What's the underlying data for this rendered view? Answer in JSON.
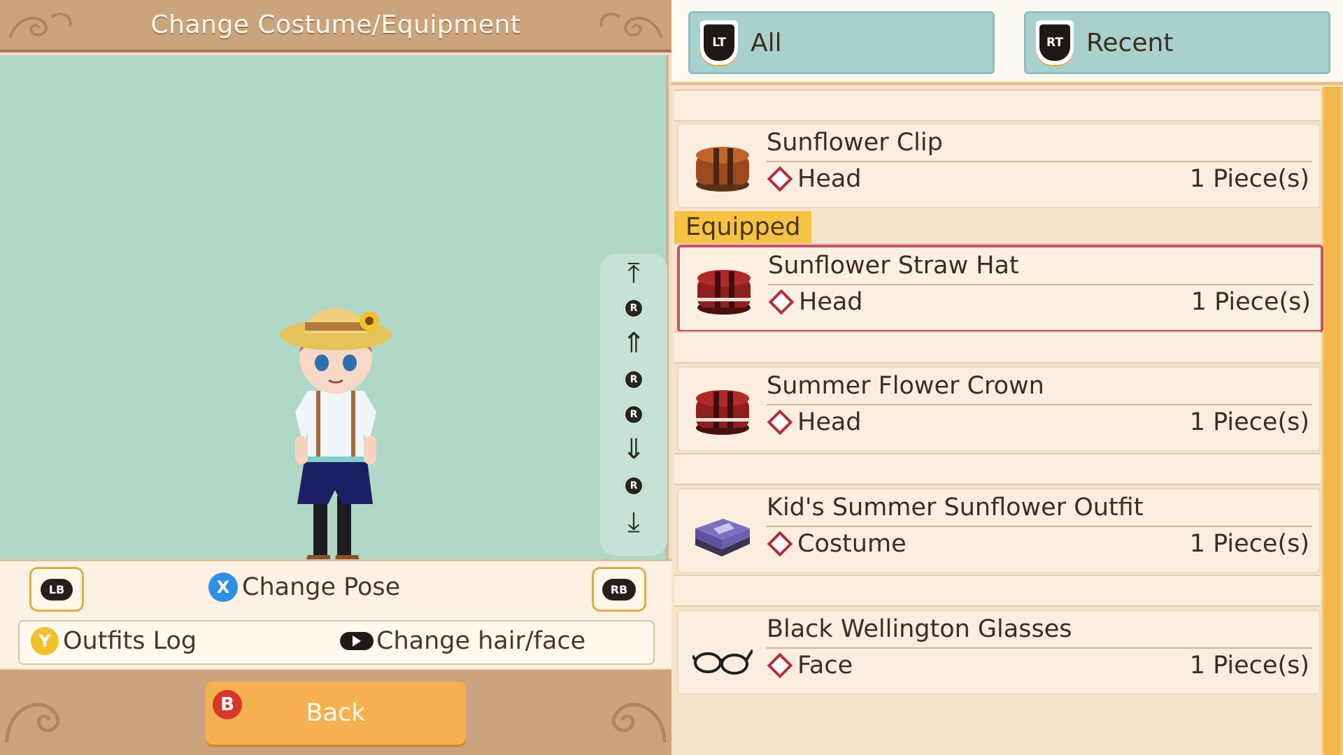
{
  "screen": {
    "title": "Change Costume/Equipment"
  },
  "preview": {
    "camera_controls": [
      "top-end",
      "rotate-up",
      "up",
      "rotate-left",
      "rotate-right",
      "down",
      "rotate-down",
      "bottom-end"
    ],
    "r_button_label": "R"
  },
  "controls": {
    "lb_label": "LB",
    "rb_label": "RB",
    "x_button": "X",
    "change_pose": "Change Pose",
    "y_button": "Y",
    "outfits_log": "Outfits Log",
    "change_hair_face": "Change hair/face"
  },
  "footer": {
    "b_button": "B",
    "back_label": "Back"
  },
  "tabs": [
    {
      "badge": "LT",
      "label": "All"
    },
    {
      "badge": "RT",
      "label": "Recent"
    }
  ],
  "equipped_label": "Equipped",
  "items": [
    {
      "name": "Sunflower Clip",
      "category": "Head",
      "quantity": "1 Piece(s)",
      "icon": "brown-box-icon",
      "selected": false
    },
    {
      "name": "Sunflower Straw Hat",
      "category": "Head",
      "quantity": "1 Piece(s)",
      "icon": "red-box-icon",
      "selected": true
    },
    {
      "name": "Summer Flower Crown",
      "category": "Head",
      "quantity": "1 Piece(s)",
      "icon": "red-box-icon",
      "selected": false
    },
    {
      "name": "Kid's Summer Sunflower Outfit",
      "category": "Costume",
      "quantity": "1 Piece(s)",
      "icon": "purple-case-icon",
      "selected": false
    },
    {
      "name": "Black Wellington Glasses",
      "category": "Face",
      "quantity": "1 Piece(s)",
      "icon": "glasses-icon",
      "selected": false
    }
  ],
  "colors": {
    "accent": "#f5b051",
    "selected_border": "#c8506a",
    "tab": "#a8d1ce",
    "preview_bg": "#b1d8c6",
    "equipped_tag": "#f5c344"
  }
}
